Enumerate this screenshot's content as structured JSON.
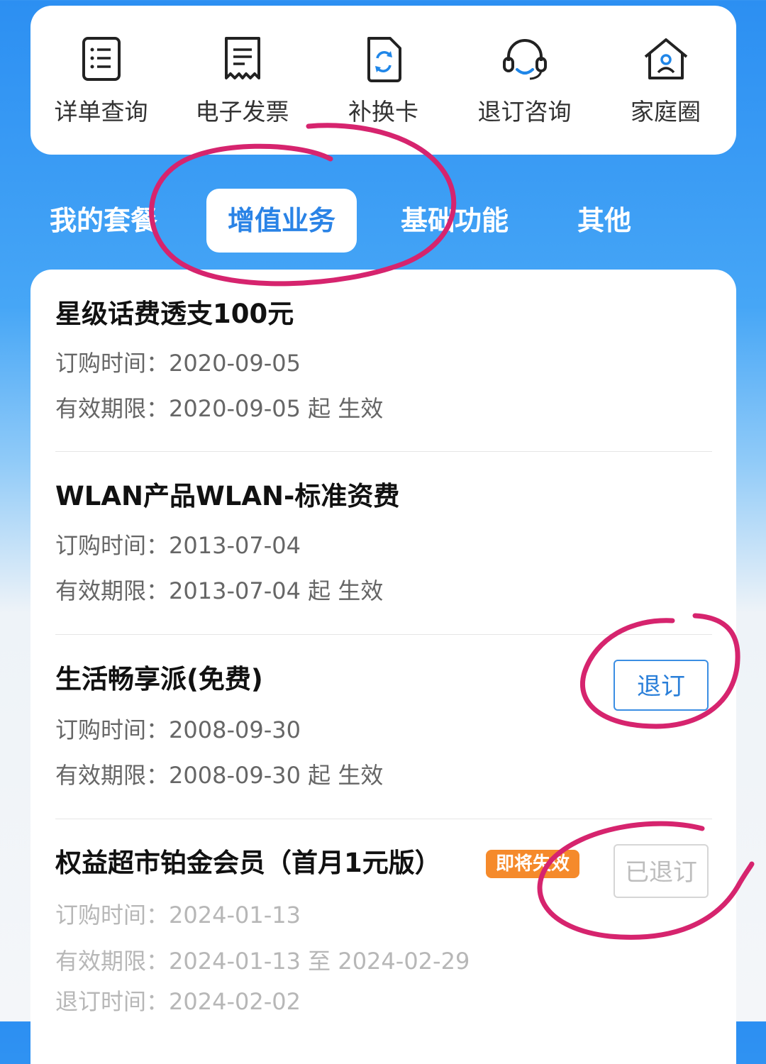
{
  "quick_actions": [
    {
      "label": "详单查询",
      "icon": "list-icon"
    },
    {
      "label": "电子发票",
      "icon": "receipt-icon"
    },
    {
      "label": "补换卡",
      "icon": "sim-swap-icon"
    },
    {
      "label": "退订咨询",
      "icon": "headset-icon"
    },
    {
      "label": "家庭圈",
      "icon": "home-user-icon"
    }
  ],
  "tabs": [
    {
      "label": "我的套餐"
    },
    {
      "label": "增值业务",
      "active": true
    },
    {
      "label": "基础功能"
    },
    {
      "label": "其他"
    }
  ],
  "services": [
    {
      "name": "星级话费透支100元",
      "order_label": "订购时间：",
      "order_date": "2020-09-05",
      "valid_label": "有效期限：",
      "valid_text": "2020-09-05 起 生效"
    },
    {
      "name": "WLAN产品WLAN-标准资费",
      "order_label": "订购时间：",
      "order_date": "2013-07-04",
      "valid_label": "有效期限：",
      "valid_text": "2013-07-04 起 生效"
    },
    {
      "name": "生活畅享派(免费)",
      "order_label": "订购时间：",
      "order_date": "2008-09-30",
      "valid_label": "有效期限：",
      "valid_text": "2008-09-30 起 生效",
      "button": "退订"
    },
    {
      "name": "权益超市铂金会员（首月1元版）",
      "badge": "即将失效",
      "order_label": "订购时间：",
      "order_date": "2024-01-13",
      "valid_label": "有效期限：",
      "valid_text": "2024-01-13 至 2024-02-29",
      "cancel_label": "退订时间：",
      "cancel_date": "2024-02-02",
      "button": "已退订"
    }
  ],
  "colors": {
    "accent": "#2a83e6",
    "badge": "#f58a2b",
    "annotation": "#d6246e"
  }
}
